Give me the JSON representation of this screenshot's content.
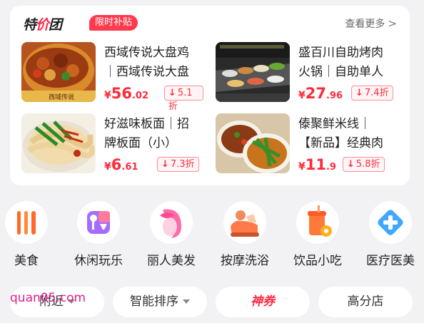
{
  "header": {
    "brand_prefix": "特",
    "brand_slash": "价",
    "brand_suffix": "团",
    "promo_badge": "限时补贴",
    "see_more": "查看更多",
    "see_more_icon": "chevron-right-icon"
  },
  "deals": [
    {
      "name": "西域传说大盘鸡｜西域传说大盘",
      "currency": "¥",
      "price_int": "56",
      "price_dec": ".02",
      "discount": "5.1折"
    },
    {
      "name": "盛百川自助烤肉火锅｜自助单人",
      "currency": "¥",
      "price_int": "27",
      "price_dec": ".96",
      "discount": "7.4折"
    },
    {
      "name": "好滋味板面｜招牌板面（小）",
      "currency": "¥",
      "price_int": "6",
      "price_dec": ".61",
      "discount": "7.3折"
    },
    {
      "name": "傣聚鲜米线｜【新品】经典肉",
      "currency": "¥",
      "price_int": "11",
      "price_dec": ".9",
      "discount": "5.8折"
    }
  ],
  "discount_arrow": "↓",
  "categories": [
    {
      "label": "美食",
      "icon": "fork-knife-icon"
    },
    {
      "label": "休闲玩乐",
      "icon": "mic-cup-icon"
    },
    {
      "label": "丽人美发",
      "icon": "beauty-face-icon"
    },
    {
      "label": "按摩洗浴",
      "icon": "massage-icon"
    },
    {
      "label": "饮品小吃",
      "icon": "drink-icon"
    },
    {
      "label": "医疗医美",
      "icon": "medical-cross-icon"
    }
  ],
  "filters": {
    "nearby": "附近",
    "sort": "智能排序",
    "coupon": "神券",
    "high_score": "高分店"
  },
  "watermark": "quan05.com"
}
